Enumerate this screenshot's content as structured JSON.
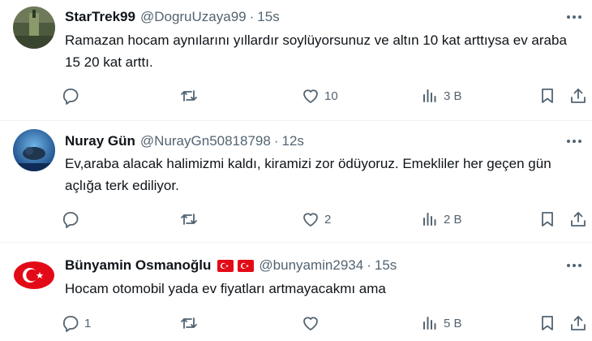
{
  "tweets": [
    {
      "name": "StarTrek99",
      "handle": "@DogruUzaya99",
      "separator": "·",
      "time": "15s",
      "text": "Ramazan hocam aynılarını yıllardır soylüyorsunuz ve altın 10 kat arttıysa ev araba 15 20 kat arttı.",
      "replies": "",
      "retweets": "",
      "likes": "10",
      "views": "3 B"
    },
    {
      "name": "Nuray Gün",
      "handle": "@NurayGn50818798",
      "separator": "·",
      "time": "12s",
      "text": "Ev,araba alacak halimizmi kaldı, kiramizi zor ödüyoruz. Emekliler her geçen gün açlığa terk ediliyor.",
      "replies": "",
      "retweets": "",
      "likes": "2",
      "views": "2 B"
    },
    {
      "name": "Bünyamin Osmanoğlu",
      "handle": "@bunyamin2934",
      "separator": "·",
      "time": "15s",
      "text": "Hocam otomobil yada ev fiyatları artmayacakmı ama",
      "replies": "1",
      "retweets": "",
      "likes": "",
      "views": "5 B"
    }
  ],
  "icons": {
    "more": "more-horizontal-icon",
    "reply": "reply-icon",
    "retweet": "retweet-icon",
    "like": "heart-icon",
    "views": "bar-chart-icon",
    "bookmark": "bookmark-icon",
    "share": "share-icon",
    "flag": "turkey-flag-icon"
  },
  "colors": {
    "text": "#0f1419",
    "secondary": "#536471",
    "separator": "#eff3f4",
    "flag": "#e30a17"
  }
}
